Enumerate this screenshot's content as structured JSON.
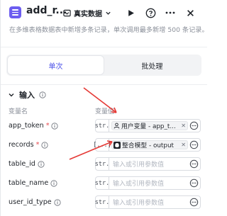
{
  "header": {
    "title": "add_r...",
    "data_toggle_label": "真实数据",
    "description": "在多维表格数据表中新增多条记录，单次调用最多新增 500 条记录。"
  },
  "tabs": [
    {
      "label": "单次",
      "active": true
    },
    {
      "label": "批处理",
      "active": false
    }
  ],
  "section": {
    "title": "输入",
    "col_name": "变量名",
    "col_value": "变量值"
  },
  "rows": [
    {
      "name": "app_token",
      "required": true,
      "type": "str.",
      "value": "用户变量 - app_t...",
      "value_icon": "user-icon"
    },
    {
      "name": "records",
      "required": true,
      "type": "[...]",
      "value": "整合模型 - output",
      "value_icon": "model-icon"
    },
    {
      "name": "table_id",
      "required": false,
      "type": "str.",
      "placeholder": "输入或引用参数值"
    },
    {
      "name": "table_name",
      "required": false,
      "type": "str.",
      "placeholder": "输入或引用参数值"
    },
    {
      "name": "user_id_type",
      "required": false,
      "type": "str.",
      "placeholder": "输入或引用参数值"
    }
  ],
  "colors": {
    "accent": "#4d53e8",
    "app_icon": "#6c5df0",
    "required": "#e5484d",
    "annotation_arrow": "#e53935"
  },
  "icons": [
    "app-icon",
    "database-icon",
    "chevron-down-icon",
    "play-icon",
    "help-icon",
    "more-icon",
    "close-icon",
    "collapse-chevron-icon",
    "info-icon",
    "user-icon",
    "model-icon",
    "reference-icon"
  ]
}
